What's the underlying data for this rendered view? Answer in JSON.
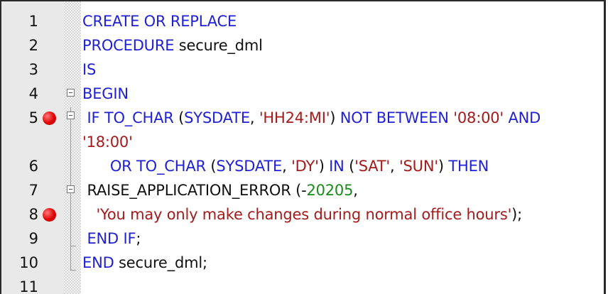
{
  "editor": {
    "lines": [
      {
        "number": "1",
        "breakpoint": false,
        "parts": [
          {
            "t": "CREATE OR REPLACE",
            "c": "kw"
          }
        ]
      },
      {
        "number": "2",
        "breakpoint": false,
        "parts": [
          {
            "t": "PROCEDURE",
            "c": "kw"
          },
          {
            "t": " secure_dml",
            "c": "id"
          }
        ]
      },
      {
        "number": "3",
        "breakpoint": false,
        "parts": [
          {
            "t": "IS",
            "c": "kw"
          }
        ]
      },
      {
        "number": "4",
        "breakpoint": false,
        "parts": [
          {
            "t": "BEGIN",
            "c": "kw"
          }
        ]
      },
      {
        "number": "5",
        "breakpoint": true,
        "parts": [
          {
            "t": " IF TO_CHAR ",
            "c": "kw"
          },
          {
            "t": "(",
            "c": "id"
          },
          {
            "t": "SYSDATE",
            "c": "kw"
          },
          {
            "t": ", ",
            "c": "id"
          },
          {
            "t": "'HH24:MI'",
            "c": "str"
          },
          {
            "t": ") ",
            "c": "id"
          },
          {
            "t": "NOT BETWEEN ",
            "c": "kw"
          },
          {
            "t": "'08:00'",
            "c": "str"
          },
          {
            "t": " AND",
            "c": "kw"
          }
        ]
      },
      {
        "number": "",
        "breakpoint": false,
        "parts": [
          {
            "t": "'18:00'",
            "c": "str"
          }
        ]
      },
      {
        "number": "6",
        "breakpoint": false,
        "parts": [
          {
            "t": "      OR TO_CHAR ",
            "c": "kw"
          },
          {
            "t": "(",
            "c": "id"
          },
          {
            "t": "SYSDATE",
            "c": "kw"
          },
          {
            "t": ", ",
            "c": "id"
          },
          {
            "t": "'DY'",
            "c": "str"
          },
          {
            "t": ") ",
            "c": "id"
          },
          {
            "t": "IN ",
            "c": "kw"
          },
          {
            "t": "(",
            "c": "id"
          },
          {
            "t": "'SAT'",
            "c": "str"
          },
          {
            "t": ", ",
            "c": "id"
          },
          {
            "t": "'SUN'",
            "c": "str"
          },
          {
            "t": ") ",
            "c": "id"
          },
          {
            "t": "THEN",
            "c": "kw"
          }
        ]
      },
      {
        "number": "7",
        "breakpoint": false,
        "parts": [
          {
            "t": " RAISE_APPLICATION_ERROR ",
            "c": "id"
          },
          {
            "t": "(-",
            "c": "id"
          },
          {
            "t": "20205",
            "c": "num"
          },
          {
            "t": ",",
            "c": "id"
          }
        ]
      },
      {
        "number": "8",
        "breakpoint": true,
        "parts": [
          {
            "t": "   ",
            "c": "id"
          },
          {
            "t": "'You may only make changes during normal office hours'",
            "c": "str"
          },
          {
            "t": ");",
            "c": "id"
          }
        ]
      },
      {
        "number": "9",
        "breakpoint": false,
        "parts": [
          {
            "t": " END IF",
            "c": "kw"
          },
          {
            "t": ";",
            "c": "id"
          }
        ]
      },
      {
        "number": "10",
        "breakpoint": false,
        "parts": [
          {
            "t": "END",
            "c": "kw"
          },
          {
            "t": " secure_dml;",
            "c": "id"
          }
        ]
      },
      {
        "number": "11",
        "breakpoint": false,
        "parts": []
      }
    ]
  }
}
